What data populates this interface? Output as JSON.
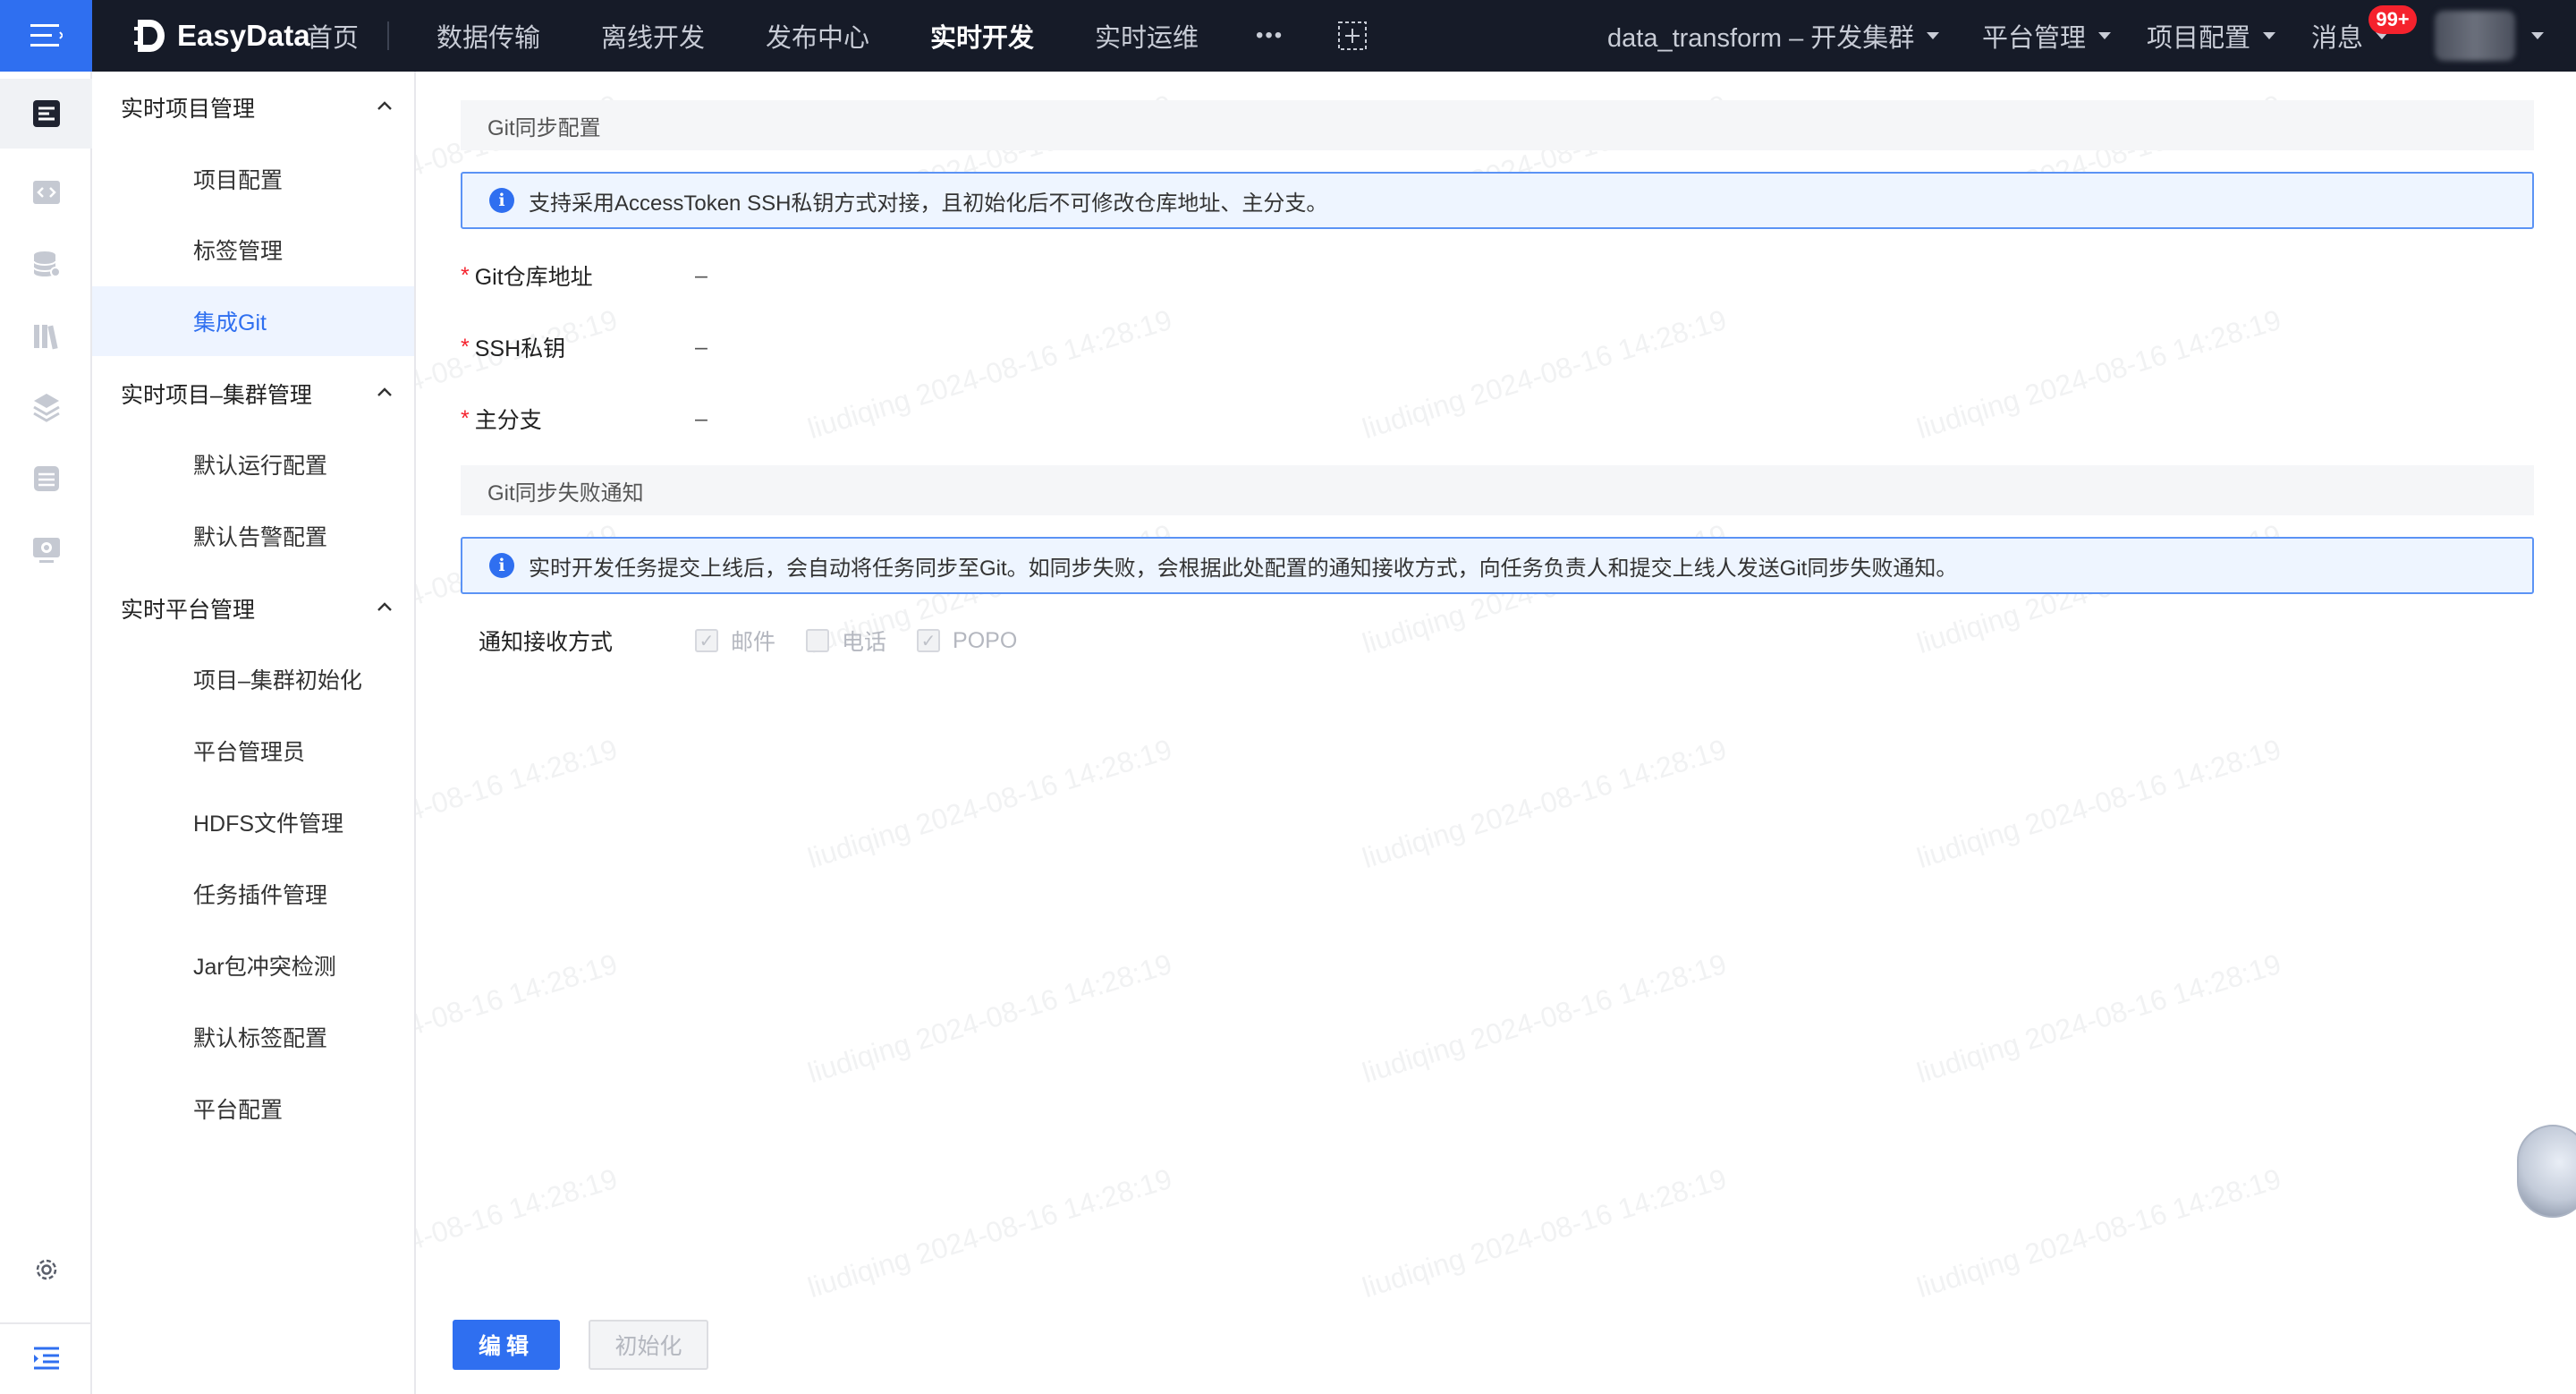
{
  "topbar": {
    "logo_text": "EasyData",
    "nav": [
      "首页",
      "数据传输",
      "离线开发",
      "发布中心",
      "实时开发",
      "实时运维"
    ],
    "active_nav": "实时开发",
    "more": "•••",
    "project_selector": "data_transform – 开发集群",
    "platform_admin": "平台管理",
    "project_config": "项目配置",
    "messages": "消息",
    "message_badge": "99+"
  },
  "sidebar": {
    "groups": [
      {
        "title": "实时项目管理",
        "items": [
          "项目配置",
          "标签管理",
          "集成Git"
        ]
      },
      {
        "title": "实时项目–集群管理",
        "items": [
          "默认运行配置",
          "默认告警配置"
        ]
      },
      {
        "title": "实时平台管理",
        "items": [
          "项目–集群初始化",
          "平台管理员",
          "HDFS文件管理",
          "任务插件管理",
          "Jar包冲突检测",
          "默认标签配置",
          "平台配置"
        ]
      }
    ],
    "active_item": "集成Git"
  },
  "main": {
    "git_sync": {
      "title": "Git同步配置",
      "notice": "支持采用AccessToken SSH私钥方式对接，且初始化后不可修改仓库地址、主分支。",
      "fields": [
        {
          "label": "Git仓库地址",
          "value": "–"
        },
        {
          "label": "SSH私钥",
          "value": "–"
        },
        {
          "label": "主分支",
          "value": "–"
        }
      ]
    },
    "fail_notify": {
      "title": "Git同步失败通知",
      "notice": "实时开发任务提交上线后，会自动将任务同步至Git。如同步失败，会根据此处配置的通知接收方式，向任务负责人和提交上线人发送Git同步失败通知。",
      "method_label": "通知接收方式",
      "methods": [
        {
          "label": "邮件",
          "checked": true
        },
        {
          "label": "电话",
          "checked": false
        },
        {
          "label": "POPO",
          "checked": true
        }
      ]
    },
    "buttons": {
      "edit": "编辑",
      "init": "初始化"
    },
    "watermark": "liudiqing 2024-08-16 14:28:19"
  },
  "icons": {
    "hamburger": "menu-icon",
    "rail": [
      "dashboard-icon",
      "code-icon",
      "database-icon",
      "library-icon",
      "layers-icon",
      "storage-icon",
      "monitor-icon",
      "settings-icon",
      "collapse-icon"
    ]
  },
  "colors": {
    "accent": "#2f6ff0",
    "topbar": "#161b28",
    "required": "#f5222d"
  }
}
